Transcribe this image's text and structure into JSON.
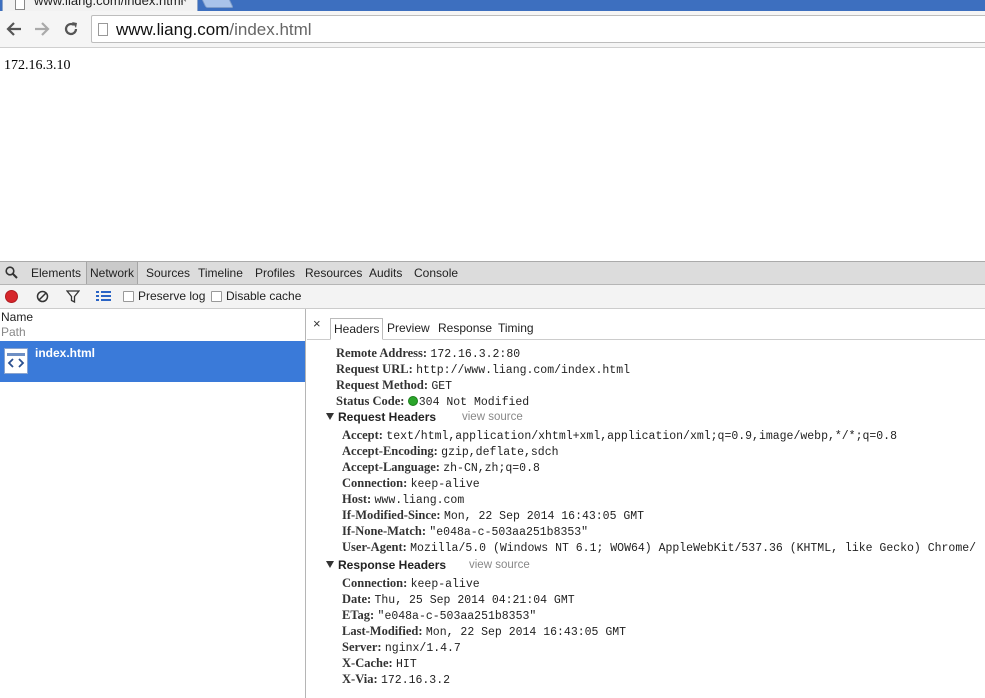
{
  "browser": {
    "tab_title": "www.liang.com/index.html",
    "tab_close": "×",
    "url_host": "www.liang.com",
    "url_path": "/index.html"
  },
  "page": {
    "body_text": "172.16.3.10"
  },
  "devtools": {
    "tabs": [
      "Elements",
      "Network",
      "Sources",
      "Timeline",
      "Profiles",
      "Resources",
      "Audits",
      "Console"
    ],
    "active_tab": "Network",
    "toolbar": {
      "preserve_log": "Preserve log",
      "disable_cache": "Disable cache"
    },
    "list": {
      "col_name": "Name",
      "col_path": "Path",
      "request_name": "index.html"
    },
    "detail": {
      "close": "×",
      "tabs": [
        "Headers",
        "Preview",
        "Response",
        "Timing"
      ],
      "active_tab": "Headers",
      "general": [
        {
          "key": "Remote Address:",
          "value": "172.16.3.2:80"
        },
        {
          "key": "Request URL:",
          "value": "http://www.liang.com/index.html"
        },
        {
          "key": "Request Method:",
          "value": "GET"
        },
        {
          "key": "Status Code:",
          "value": "304 Not Modified"
        }
      ],
      "status_color": "#2aa52a",
      "request_headers_title": "Request Headers",
      "response_headers_title": "Response Headers",
      "view_source": "view source",
      "request_headers": [
        {
          "key": "Accept:",
          "value": "text/html,application/xhtml+xml,application/xml;q=0.9,image/webp,*/*;q=0.8"
        },
        {
          "key": "Accept-Encoding:",
          "value": "gzip,deflate,sdch"
        },
        {
          "key": "Accept-Language:",
          "value": "zh-CN,zh;q=0.8"
        },
        {
          "key": "Connection:",
          "value": "keep-alive"
        },
        {
          "key": "Host:",
          "value": "www.liang.com"
        },
        {
          "key": "If-Modified-Since:",
          "value": "Mon, 22 Sep 2014 16:43:05 GMT"
        },
        {
          "key": "If-None-Match:",
          "value": "\"e048a-c-503aa251b8353\""
        },
        {
          "key": "User-Agent:",
          "value": "Mozilla/5.0 (Windows NT 6.1; WOW64) AppleWebKit/537.36 (KHTML, like Gecko) Chrome/"
        }
      ],
      "response_headers": [
        {
          "key": "Connection:",
          "value": "keep-alive"
        },
        {
          "key": "Date:",
          "value": "Thu, 25 Sep 2014 04:21:04 GMT"
        },
        {
          "key": "ETag:",
          "value": "\"e048a-c-503aa251b8353\""
        },
        {
          "key": "Last-Modified:",
          "value": "Mon, 22 Sep 2014 16:43:05 GMT"
        },
        {
          "key": "Server:",
          "value": "nginx/1.4.7"
        },
        {
          "key": "X-Cache:",
          "value": "HIT"
        },
        {
          "key": "X-Via:",
          "value": "172.16.3.2"
        }
      ]
    }
  }
}
